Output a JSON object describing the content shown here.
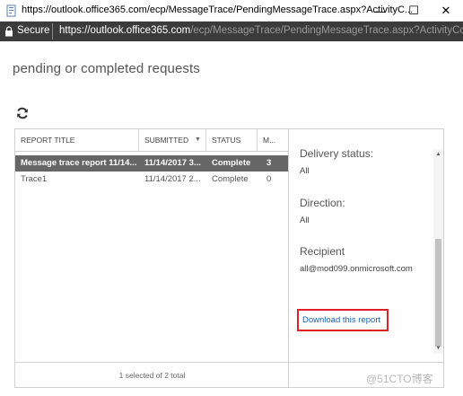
{
  "window": {
    "title": "https://outlook.office365.com/ecp/MessageTrace/PendingMessageTrace.aspx?ActivityC...",
    "minimize_symbol": "—",
    "maximize_symbol": "☐",
    "close_symbol": "✕"
  },
  "address_bar": {
    "secure_label": "Secure",
    "url_host": "https://outlook.office365.com",
    "url_path": "/ecp/MessageTrace/PendingMessageTrace.aspx?ActivityCo..."
  },
  "page": {
    "heading": "pending or completed requests"
  },
  "table": {
    "columns": [
      "REPORT TITLE",
      "SUBMITTED",
      "STATUS",
      "M..."
    ],
    "sort_indicator": "▼",
    "rows": [
      {
        "title": "Message trace report 11/14...",
        "submitted": "11/14/2017 3...",
        "status": "Complete",
        "m": "3",
        "selected": true
      },
      {
        "title": "Trace1",
        "submitted": "11/14/2017 2...",
        "status": "Complete",
        "m": "0",
        "selected": false
      }
    ],
    "footer": "1 selected of 2 total"
  },
  "details": {
    "delivery_status_label": "Delivery status:",
    "delivery_status_value": "All",
    "direction_label": "Direction:",
    "direction_value": "All",
    "recipient_label": "Recipient",
    "recipient_value": "all@mod099.onmicrosoft.com",
    "download_link": "Download this report",
    "scroll_up_symbol": "▲",
    "scroll_down_symbol": "▼"
  },
  "watermark": "@51CTO博客",
  "icons": {
    "app": "document-page-icon",
    "lock": "lock-icon",
    "refresh": "refresh-icon"
  },
  "colors": {
    "selected_row": "#666666",
    "link": "#1a5fb4",
    "highlight_box": "#e0202a",
    "address_bar": "#3b3b3b"
  }
}
